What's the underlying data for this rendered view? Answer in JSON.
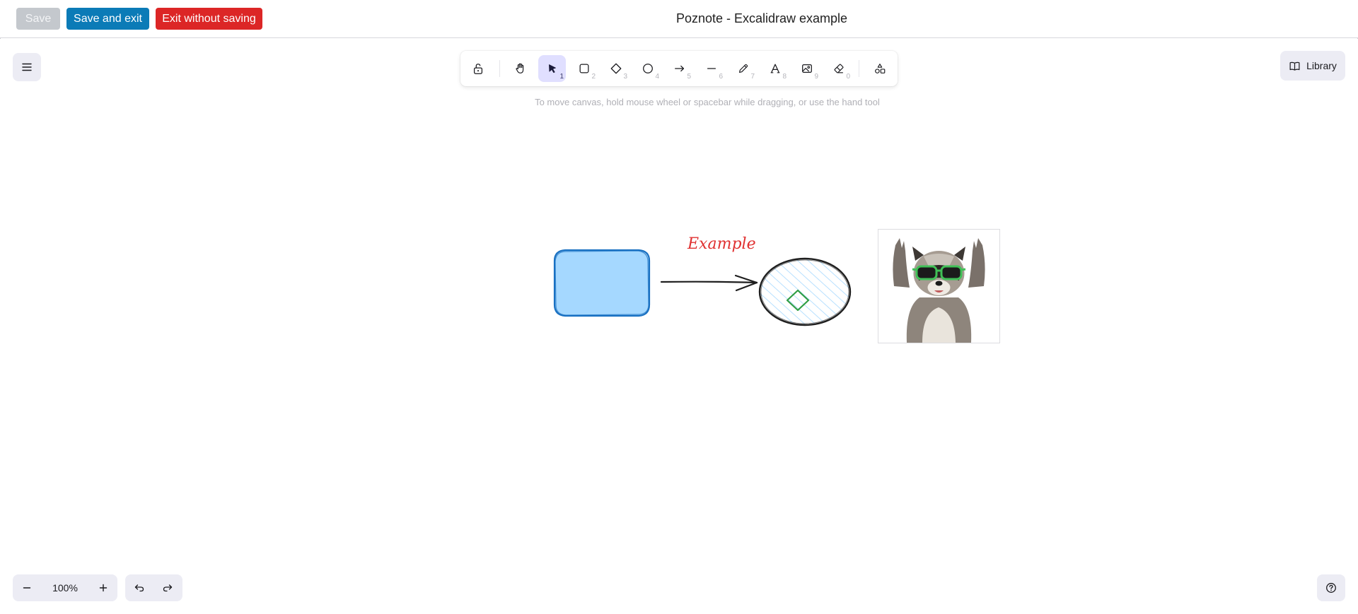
{
  "header": {
    "save_label": "Save",
    "save_exit_label": "Save and exit",
    "exit_label": "Exit without saving",
    "title": "Poznote - Excalidraw example"
  },
  "toolbar": {
    "tools": [
      {
        "name": "lock",
        "icon": "lock-open-icon",
        "key": ""
      },
      {
        "name": "hand",
        "icon": "hand-icon",
        "key": ""
      },
      {
        "name": "selection",
        "icon": "pointer-icon",
        "key": "1",
        "active": true
      },
      {
        "name": "rectangle",
        "icon": "rectangle-icon",
        "key": "2"
      },
      {
        "name": "diamond",
        "icon": "diamond-icon",
        "key": "3"
      },
      {
        "name": "ellipse",
        "icon": "circle-icon",
        "key": "4"
      },
      {
        "name": "arrow",
        "icon": "arrow-icon",
        "key": "5"
      },
      {
        "name": "line",
        "icon": "line-icon",
        "key": "6"
      },
      {
        "name": "draw",
        "icon": "pencil-icon",
        "key": "7"
      },
      {
        "name": "text",
        "icon": "text-icon",
        "key": "8"
      },
      {
        "name": "image",
        "icon": "image-icon",
        "key": "9"
      },
      {
        "name": "eraser",
        "icon": "eraser-icon",
        "key": "0"
      },
      {
        "name": "extra-tools",
        "icon": "shapes-icon",
        "key": ""
      }
    ]
  },
  "library": {
    "label": "Library"
  },
  "hint": "To move canvas, hold mouse wheel or spacebar while dragging, or use the hand tool",
  "zoom": {
    "level": "100%"
  },
  "canvas": {
    "text_element": "Example",
    "colors": {
      "rectangle_fill": "#a5d8ff",
      "rectangle_stroke": "#1971c2",
      "text": "#e03131",
      "arrow": "#1e1e1e",
      "ellipse_stroke": "#1e1e1e",
      "ellipse_hatch": "#a5d8ff",
      "diamond_stroke": "#2f9e44",
      "sunglasses": "#40c057"
    },
    "image_subject": "raccoon-with-sunglasses"
  },
  "theme": {
    "accent": "#0b7bb7",
    "danger": "#dc2626",
    "disabled": "#c4c8cd",
    "tool_active": "#e0dfff",
    "island_bg": "#ececf4"
  }
}
